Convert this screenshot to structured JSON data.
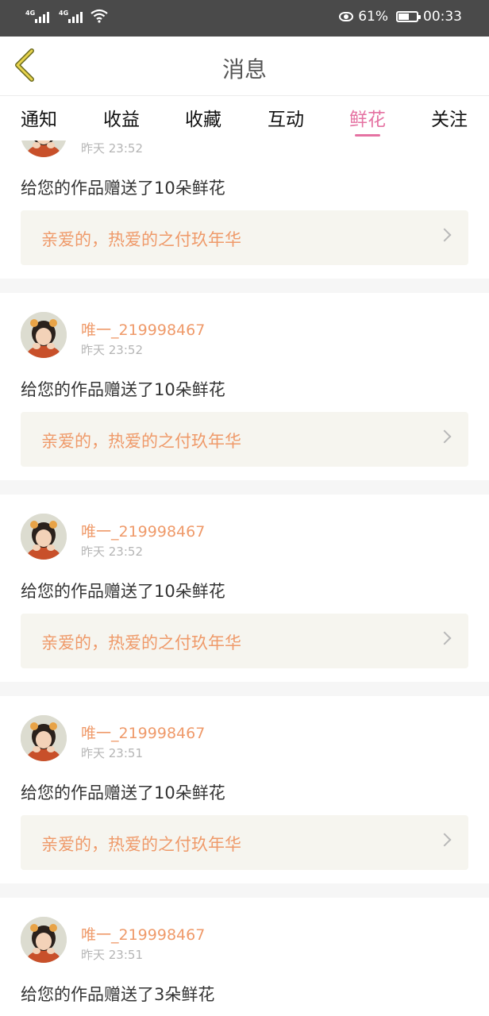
{
  "status_bar": {
    "signal_1": "4G",
    "signal_2": "4G",
    "battery_percent": "61%",
    "battery_level": 0.61,
    "time": "00:33"
  },
  "header": {
    "back_icon": "chevron-left-icon",
    "title": "消息"
  },
  "tabs": [
    {
      "label": "通知",
      "active": false
    },
    {
      "label": "收益",
      "active": false
    },
    {
      "label": "收藏",
      "active": false
    },
    {
      "label": "互动",
      "active": false
    },
    {
      "label": "鲜花",
      "active": true
    },
    {
      "label": "关注",
      "active": false
    }
  ],
  "accent_color": "#e572a2",
  "name_color": "#ef9a6a",
  "messages": [
    {
      "user": "",
      "time": "昨天 23:52",
      "text": "给您的作品赠送了10朵鲜花",
      "work": "亲爱的，热爱的之付玖年华"
    },
    {
      "user": "唯一_219998467",
      "time": "昨天 23:52",
      "text": "给您的作品赠送了10朵鲜花",
      "work": "亲爱的，热爱的之付玖年华"
    },
    {
      "user": "唯一_219998467",
      "time": "昨天 23:52",
      "text": "给您的作品赠送了10朵鲜花",
      "work": "亲爱的，热爱的之付玖年华"
    },
    {
      "user": "唯一_219998467",
      "time": "昨天 23:51",
      "text": "给您的作品赠送了10朵鲜花",
      "work": "亲爱的，热爱的之付玖年华"
    },
    {
      "user": "唯一_219998467",
      "time": "昨天 23:51",
      "text": "给您的作品赠送了3朵鲜花",
      "work": ""
    }
  ]
}
